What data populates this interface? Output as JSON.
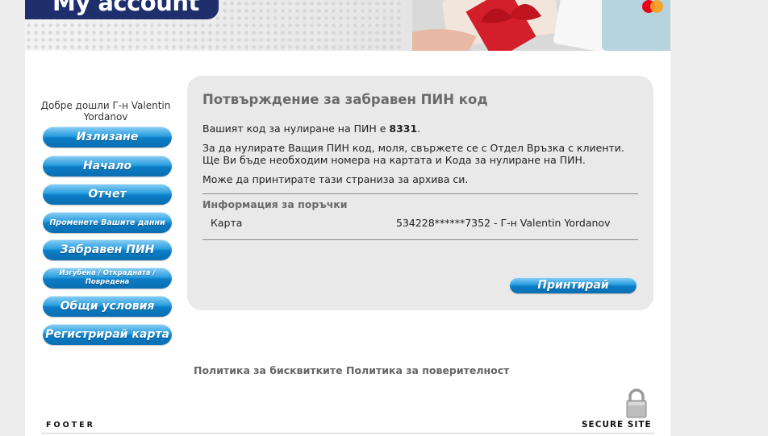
{
  "header": {
    "logo_text": "My account"
  },
  "sidebar": {
    "welcome": "Добре дошли Г-н Valentin Yordanov",
    "items": [
      {
        "label": "Излизане"
      },
      {
        "label": "Начало"
      },
      {
        "label": "Отчет"
      },
      {
        "label": "Променете Вашите данни"
      },
      {
        "label": "Забравен ПИН"
      },
      {
        "label": "Изгубена / Откраднатa / Повредена"
      },
      {
        "label": "Общи условия"
      },
      {
        "label": "Регистрирай карта"
      }
    ]
  },
  "main": {
    "title": "Потвърждение за забравен ПИН код",
    "reset_code_prefix": "Вашият код за нулиране на ПИН е ",
    "reset_code": "8331",
    "reset_code_suffix": ".",
    "instructions": "За да нулирате Ващия ПИН код, моля, свържете се с Отдел Връзка с клиенти. Ще Ви бъде необходим номера на картата и Кода за нулиране на ПИН.",
    "print_note": "Може да принтирате тази страниза за архива си.",
    "order_info_heading": "Информация за поръчки",
    "card_label": "Карта",
    "card_value": "534228******7352 - Г-н Valentin Yordanov",
    "print_button": "Принтирай"
  },
  "footer": {
    "cookie_policy": "Политика за бисквитките",
    "privacy_policy": "Политика за поверителност",
    "footer_label": "FOOTER",
    "secure_label": "SECURE SITE"
  },
  "colors": {
    "brand_navy": "#1f2f6e",
    "button_blue": "#0b7dc6",
    "panel_bg": "#e9e9e9"
  }
}
